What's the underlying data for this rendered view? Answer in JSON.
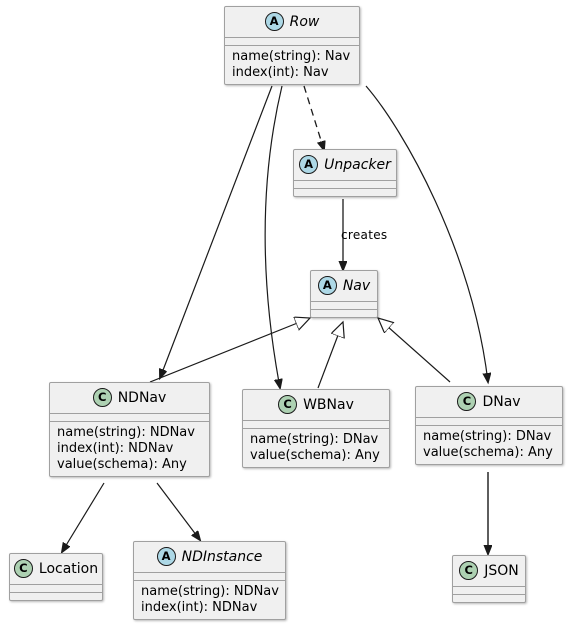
{
  "diagram": {
    "type": "uml-class-diagram",
    "background": "#FFFFFF",
    "abstract_icon_color": "#ADD8E6",
    "class_icon_color": "#ADD1B2",
    "node_fill": "#F0F0F0",
    "node_border": "#A0A0A0",
    "abstract_icon_letter": "A",
    "class_icon_letter": "C"
  },
  "nodes": {
    "row": {
      "name": "Row",
      "stereotype": "A",
      "abstract": true,
      "attributes": [
        "name(string): Nav",
        "index(int): Nav"
      ]
    },
    "unpacker": {
      "name": "Unpacker",
      "stereotype": "A",
      "abstract": true,
      "attributes": []
    },
    "nav": {
      "name": "Nav",
      "stereotype": "A",
      "abstract": true,
      "attributes": []
    },
    "ndnav": {
      "name": "NDNav",
      "stereotype": "C",
      "abstract": false,
      "attributes": [
        "name(string): NDNav",
        "index(int): NDNav",
        "value(schema): Any"
      ]
    },
    "wbnav": {
      "name": "WBNav",
      "stereotype": "C",
      "abstract": false,
      "attributes": [
        "name(string): DNav",
        "value(schema): Any"
      ]
    },
    "dnav": {
      "name": "DNav",
      "stereotype": "C",
      "abstract": false,
      "attributes": [
        "name(string): DNav",
        "value(schema): Any"
      ]
    },
    "location": {
      "name": "Location",
      "stereotype": "C",
      "abstract": false,
      "attributes": []
    },
    "ndinstance": {
      "name": "NDInstance",
      "stereotype": "A",
      "abstract": true,
      "attributes": [
        "name(string): NDNav",
        "index(int): NDNav"
      ]
    },
    "json": {
      "name": "JSON",
      "stereotype": "C",
      "abstract": false,
      "attributes": []
    }
  },
  "edges": [
    {
      "from": "row",
      "to": "unpacker",
      "style": "dashed",
      "arrow": "open",
      "label": ""
    },
    {
      "from": "unpacker",
      "to": "nav",
      "style": "solid",
      "arrow": "open",
      "label": "creates"
    },
    {
      "from": "row",
      "to": "ndnav",
      "style": "solid",
      "arrow": "open",
      "label": ""
    },
    {
      "from": "row",
      "to": "wbnav",
      "style": "solid",
      "arrow": "open",
      "label": ""
    },
    {
      "from": "row",
      "to": "dnav",
      "style": "solid",
      "arrow": "open",
      "label": ""
    },
    {
      "from": "ndnav",
      "to": "nav",
      "style": "solid",
      "arrow": "inheritance",
      "label": ""
    },
    {
      "from": "wbnav",
      "to": "nav",
      "style": "solid",
      "arrow": "inheritance",
      "label": ""
    },
    {
      "from": "dnav",
      "to": "nav",
      "style": "solid",
      "arrow": "inheritance",
      "label": ""
    },
    {
      "from": "ndnav",
      "to": "location",
      "style": "solid",
      "arrow": "open",
      "label": ""
    },
    {
      "from": "ndnav",
      "to": "ndinstance",
      "style": "solid",
      "arrow": "open",
      "label": ""
    },
    {
      "from": "dnav",
      "to": "json",
      "style": "solid",
      "arrow": "open",
      "label": ""
    }
  ],
  "labels": {
    "creates": "creates"
  }
}
